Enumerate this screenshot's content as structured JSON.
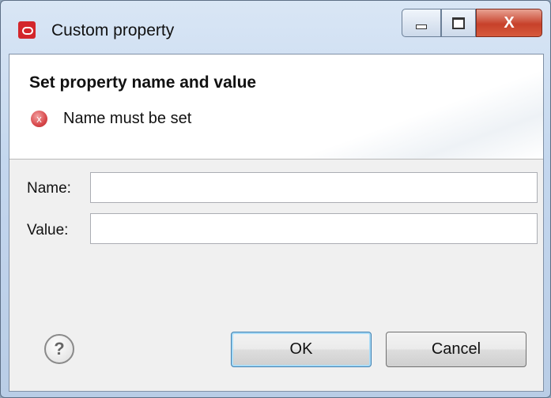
{
  "window": {
    "title": "Custom property",
    "minimize_label": "",
    "maximize_label": "",
    "close_label": "X"
  },
  "banner": {
    "title": "Set property name and value",
    "error_message": "Name must be set",
    "error_icon": "error-x-icon",
    "error_glyph": "x"
  },
  "form": {
    "name_label": "Name:",
    "name_value": "",
    "value_label": "Value:",
    "value_value": ""
  },
  "buttons": {
    "help_glyph": "?",
    "ok_label": "OK",
    "cancel_label": "Cancel"
  }
}
